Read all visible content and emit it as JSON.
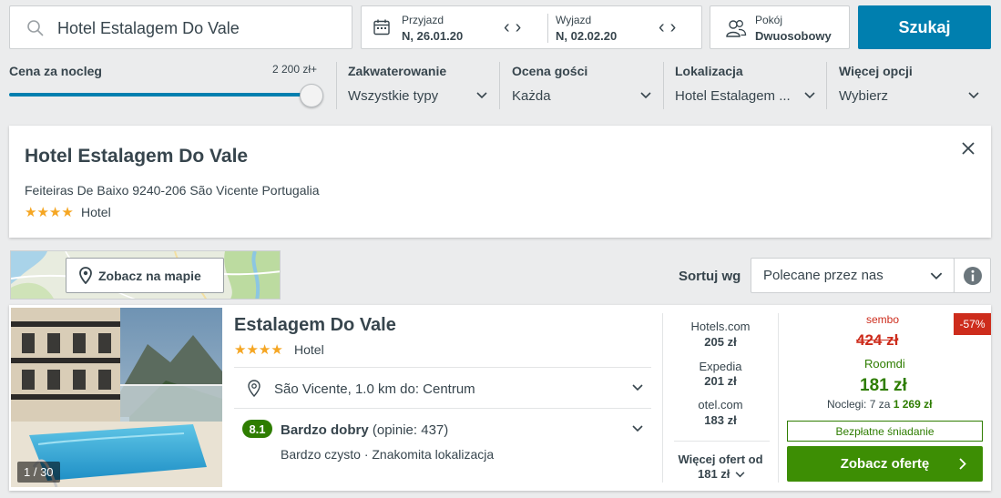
{
  "search": {
    "destination": "Hotel Estalagem Do Vale"
  },
  "dates": {
    "checkin_label": "Przyjazd",
    "checkin_value": "N, 26.01.20",
    "checkout_label": "Wyjazd",
    "checkout_value": "N, 02.02.20"
  },
  "room": {
    "label": "Pokój",
    "value": "Dwuosobowy"
  },
  "search_button": "Szukaj",
  "filters": {
    "price": {
      "title": "Cena za nocleg",
      "max": "2 200 zł+"
    },
    "accommodation": {
      "title": "Zakwaterowanie",
      "value": "Wszystkie typy"
    },
    "rating": {
      "title": "Ocena gości",
      "value": "Każda"
    },
    "location": {
      "title": "Lokalizacja",
      "value": "Hotel Estalagem ..."
    },
    "more": {
      "title": "Więcej opcji",
      "value": "Wybierz"
    }
  },
  "info_card": {
    "name": "Hotel Estalagem Do Vale",
    "address": "Feiteiras De Baixo 9240-206 São Vicente Portugalia",
    "stars": 4,
    "type": "Hotel"
  },
  "map": {
    "button_label": "Zobacz na mapie"
  },
  "sort": {
    "label": "Sortuj wg",
    "value": "Polecane przez nas"
  },
  "result": {
    "photo_counter": "1 / 30",
    "name": "Estalagem Do Vale",
    "stars": 4,
    "type": "Hotel",
    "location": "São Vicente, 1.0 km do: Centrum",
    "rating_score": "8.1",
    "rating_text": "Bardzo dobry",
    "rating_reviews": "(opinie: 437)",
    "highlights": "Bardzo czysto · Znakomita lokalizacja",
    "otas": [
      {
        "name": "Hotels.com",
        "price": "205 zł"
      },
      {
        "name": "Expedia",
        "price": "201 zł"
      },
      {
        "name": "otel.com",
        "price": "183 zł"
      }
    ],
    "more_offers_label": "Więcej ofert od",
    "more_offers_price": "181 zł",
    "deal": {
      "old_provider": "sembo",
      "old_price": "424 zł",
      "discount": "-57%",
      "provider": "Roomdi",
      "price": "181 zł",
      "nights_label": "Noclegi: 7 za",
      "nights_total": "1 269 zł",
      "breakfast": "Bezpłatne śniadanie",
      "button": "Zobacz ofertę"
    }
  },
  "colors": {
    "primary_blue": "#007faf",
    "green_cta": "#3d8e04",
    "discount_red": "#cd2c1c",
    "star": "#f5a623"
  }
}
